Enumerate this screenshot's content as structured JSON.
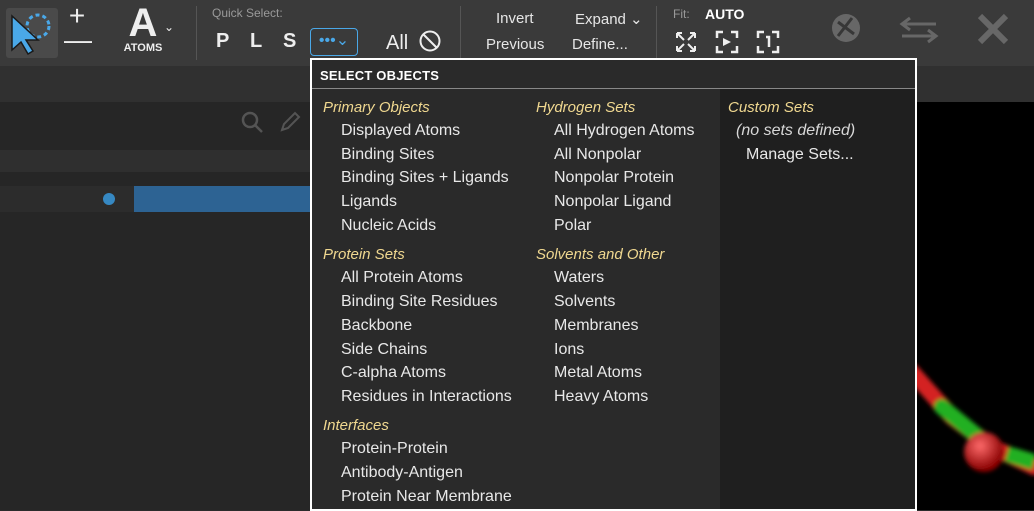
{
  "toolbar": {
    "atoms_letter": "A",
    "atoms_label": "ATOMS",
    "quick_select_label": "Quick Select:",
    "quick_select_buttons": [
      "P",
      "L",
      "S"
    ],
    "more_label": "•••⌄",
    "all_label": "All",
    "invert_label": "Invert",
    "previous_label": "Previous",
    "expand_label": "Expand ⌄",
    "define_label": "Define...",
    "fit_label": "Fit:",
    "fit_value": "AUTO"
  },
  "popup": {
    "title": "SELECT OBJECTS",
    "columns": [
      {
        "groups": [
          {
            "heading": "Primary Objects",
            "items": [
              "Displayed Atoms",
              "Binding Sites",
              "Binding Sites + Ligands",
              "Ligands",
              "Nucleic Acids"
            ]
          },
          {
            "heading": "Protein Sets",
            "items": [
              "All Protein Atoms",
              "Binding Site Residues",
              "Backbone",
              "Side Chains",
              "C-alpha Atoms",
              "Residues in Interactions"
            ]
          },
          {
            "heading": "Interfaces",
            "items": [
              "Protein-Protein",
              "Antibody-Antigen",
              "Protein Near Membrane"
            ]
          }
        ]
      },
      {
        "groups": [
          {
            "heading": "Hydrogen Sets",
            "items": [
              "All Hydrogen Atoms",
              "All Nonpolar",
              "Nonpolar Protein",
              "Nonpolar Ligand",
              "Polar"
            ]
          },
          {
            "heading": "Solvents and Other",
            "items": [
              "Waters",
              "Solvents",
              "Membranes",
              "Ions",
              "Metal Atoms",
              "Heavy Atoms"
            ]
          }
        ]
      }
    ],
    "custom": {
      "heading": "Custom Sets",
      "empty_note": "(no sets defined)",
      "manage_label": "Manage Sets..."
    }
  },
  "colors": {
    "accent": "#4aa8e8",
    "heading": "#f0d890",
    "popup_bg": "#2a2a2a",
    "toolbar_bg": "#3a3a3a"
  }
}
